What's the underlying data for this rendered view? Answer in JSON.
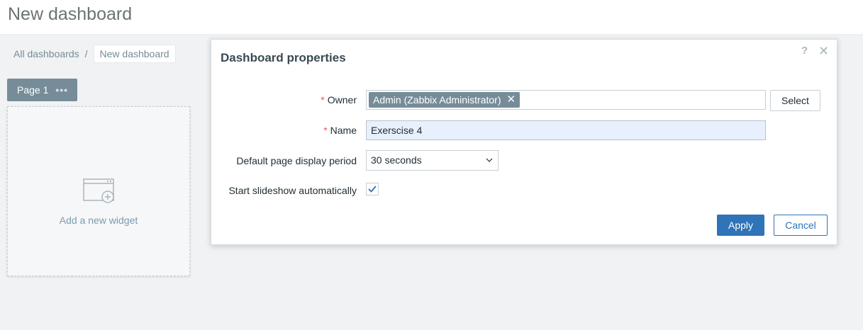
{
  "page": {
    "title": "New dashboard"
  },
  "breadcrumb": {
    "all_dashboards": "All dashboards",
    "separator": "/",
    "current": "New dashboard"
  },
  "page_tab": {
    "label": "Page 1",
    "menu": "•••"
  },
  "widget_placeholder": {
    "label": "Add a new widget",
    "icon": "add-widget-icon"
  },
  "modal": {
    "title": "Dashboard properties",
    "help": "?",
    "close": "✕",
    "fields": {
      "owner": {
        "required_mark": "*",
        "label": "Owner",
        "value": "Admin (Zabbix Administrator)",
        "remove": "✕",
        "select_label": "Select"
      },
      "name": {
        "required_mark": "*",
        "label": "Name",
        "value": "Exerscise 4"
      },
      "period": {
        "label": "Default page display period",
        "value": "30 seconds"
      },
      "slideshow": {
        "label": "Start slideshow automatically",
        "checked": true
      }
    },
    "buttons": {
      "apply": "Apply",
      "cancel": "Cancel"
    }
  },
  "colors": {
    "accent": "#2f73b8",
    "chip": "#768d99",
    "required": "#e45959"
  }
}
